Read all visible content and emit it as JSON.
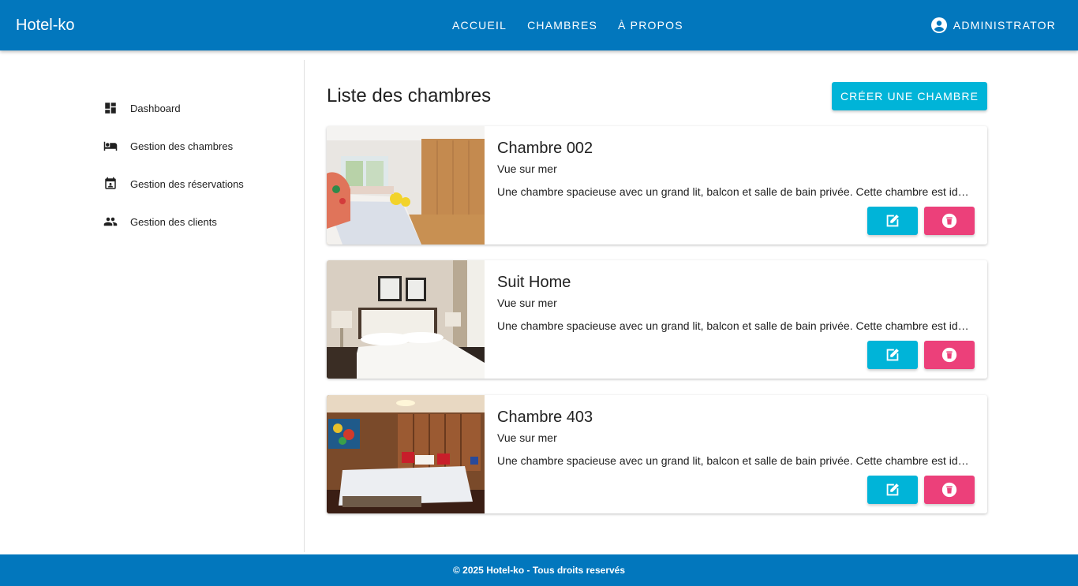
{
  "header": {
    "brand": "Hotel-ko",
    "nav": [
      "ACCUEIL",
      "CHAMBRES",
      "À PROPOS"
    ],
    "user_label": "ADMINISTRATOR",
    "user_icon": "account-circle-icon"
  },
  "sidebar": {
    "items": [
      {
        "label": "Dashboard",
        "icon": "dashboard-icon"
      },
      {
        "label": "Gestion des chambres",
        "icon": "bed-icon"
      },
      {
        "label": "Gestion des réservations",
        "icon": "calendar-icon"
      },
      {
        "label": "Gestion des clients",
        "icon": "people-icon"
      }
    ]
  },
  "main": {
    "title": "Liste des chambres",
    "create_label": "CRÉER UNE CHAMBRE",
    "rooms": [
      {
        "name": "Chambre 002",
        "subtitle": "Vue sur mer",
        "description": "Une chambre spacieuse avec un grand lit, balcon et salle de bain privée. Cette chambre est idéale pour un séjour confortable."
      },
      {
        "name": "Suit Home",
        "subtitle": "Vue sur mer",
        "description": "Une chambre spacieuse avec un grand lit, balcon et salle de bain privée. Cette chambre est idéale pour un séjour confortable."
      },
      {
        "name": "Chambre 403",
        "subtitle": "Vue sur mer",
        "description": "Une chambre spacieuse avec un grand lit, balcon et salle de bain privée. Cette chambre est idéale pour un séjour confortable."
      }
    ]
  },
  "footer": {
    "text": "© 2025 Hotel-ko - Tous droits reservés"
  },
  "colors": {
    "primary": "#0277bd",
    "accent_cyan": "#00b4d8",
    "accent_pink": "#ec407a"
  }
}
